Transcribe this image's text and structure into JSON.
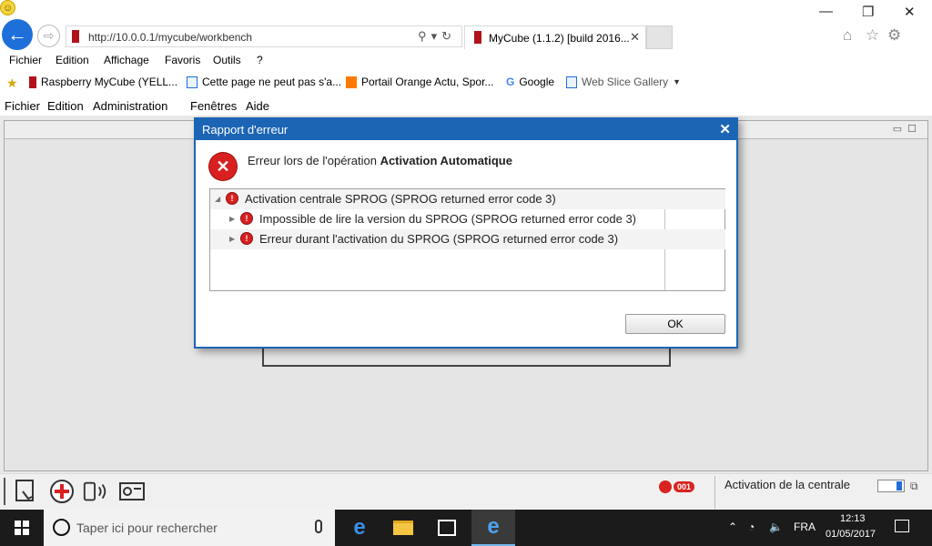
{
  "browser": {
    "url": "http://10.0.0.1/mycube/workbench",
    "tab_title": "MyCube (1.1.2) [build 2016...",
    "menu": [
      "Fichier",
      "Edition",
      "Affichage",
      "Favoris",
      "Outils",
      "?"
    ],
    "favorites": [
      {
        "label": "Raspberry MyCube (YELL...",
        "icon": "mycube-favicon"
      },
      {
        "label": "Cette page ne peut pas s'a...",
        "icon": "ie-page-icon"
      },
      {
        "label": "Portail Orange  Actu, Spor...",
        "icon": "orange-icon"
      },
      {
        "label": "Google",
        "icon": "google-icon"
      },
      {
        "label": "Web Slice Gallery",
        "icon": "ie-page-icon"
      }
    ]
  },
  "app": {
    "menu": [
      "Fichier",
      "Edition",
      "Administration",
      "Fenêtres",
      "Aide"
    ],
    "status_text": "Activation de la centrale",
    "alert_count": "001"
  },
  "dialog": {
    "title": "Rapport d'erreur",
    "message_prefix": "Erreur lors de l'opération ",
    "message_bold": "Activation Automatique",
    "errors": [
      {
        "text": "Activation centrale SPROG (SPROG returned error code 3)",
        "level": 0,
        "expanded": true
      },
      {
        "text": "Impossible de lire la version du SPROG (SPROG returned error code 3)",
        "level": 1,
        "expanded": false
      },
      {
        "text": "Erreur durant l'activation du SPROG (SPROG returned error code 3)",
        "level": 1,
        "expanded": false
      }
    ],
    "ok_label": "OK"
  },
  "taskbar": {
    "search_placeholder": "Taper ici pour rechercher",
    "language": "FRA",
    "time": "12:13",
    "date": "01/05/2017"
  },
  "colors": {
    "dialog_blue": "#1c65b5",
    "error_red": "#d92020",
    "ie_blue": "#1e6fd9"
  }
}
